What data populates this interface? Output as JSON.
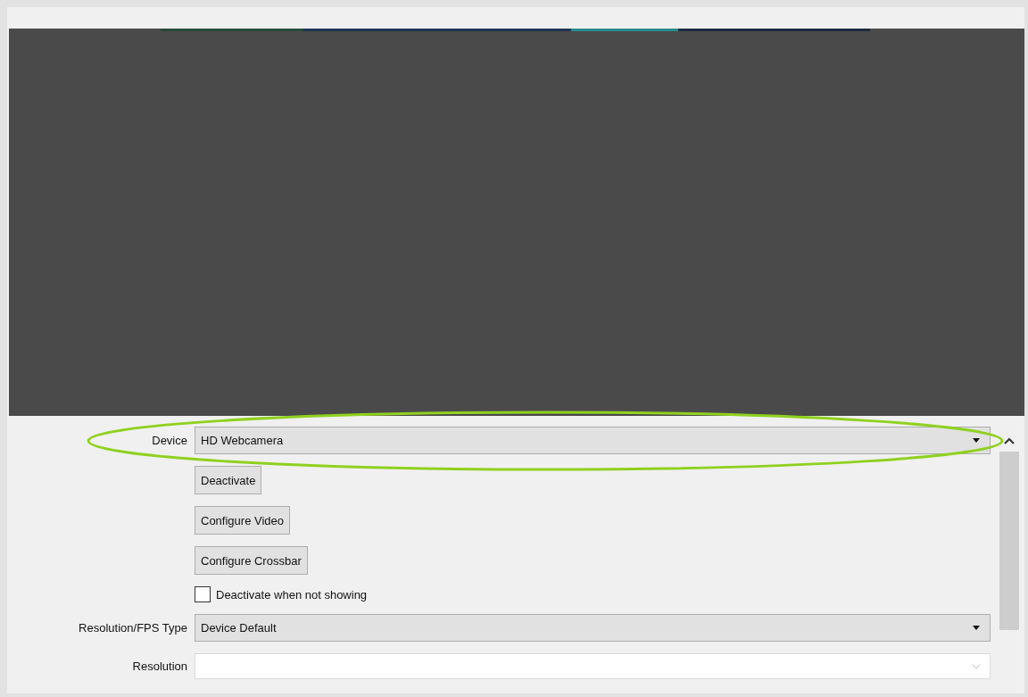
{
  "properties": [
    {
      "kind": "combo",
      "label": "Device",
      "value": "HD Webcamera",
      "disabled": false,
      "highlighted": true
    },
    {
      "kind": "button",
      "label": "Deactivate"
    },
    {
      "kind": "button",
      "label": "Configure Video"
    },
    {
      "kind": "button",
      "label": "Configure Crossbar"
    },
    {
      "kind": "checkbox",
      "label": "Deactivate when not showing",
      "checked": false
    },
    {
      "kind": "combo",
      "label": "Resolution/FPS Type",
      "value": "Device Default",
      "disabled": false,
      "highlighted": false
    },
    {
      "kind": "combo",
      "label": "Resolution",
      "disabled": true,
      "highlighted": false
    }
  ]
}
